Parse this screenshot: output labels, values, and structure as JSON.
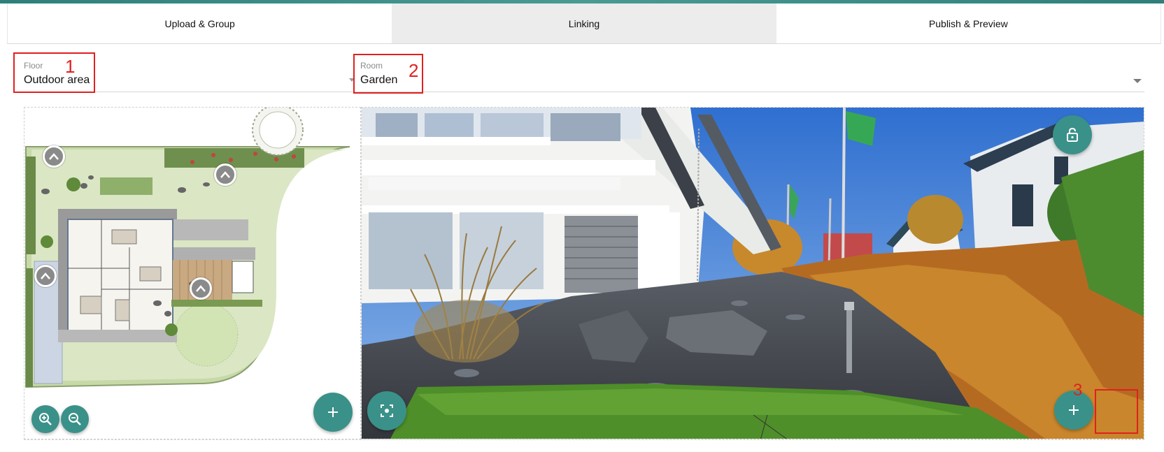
{
  "tabs": [
    {
      "label": "Upload & Group",
      "active": false
    },
    {
      "label": "Linking",
      "active": true
    },
    {
      "label": "Publish & Preview",
      "active": false
    }
  ],
  "floor": {
    "label": "Floor",
    "value": "Outdoor area"
  },
  "room": {
    "label": "Room",
    "value": "Garden"
  },
  "annotations": [
    "1",
    "2",
    "3"
  ],
  "icons": {
    "zoom_in": "zoom-in-icon",
    "zoom_out": "zoom-out-icon",
    "add": "plus-icon",
    "lock": "lock-icon",
    "focus": "focus-icon",
    "marker": "chevron-up-icon"
  },
  "colors": {
    "accent": "#3a9189",
    "annotation": "#e02020",
    "active_tab": "#ececec"
  }
}
